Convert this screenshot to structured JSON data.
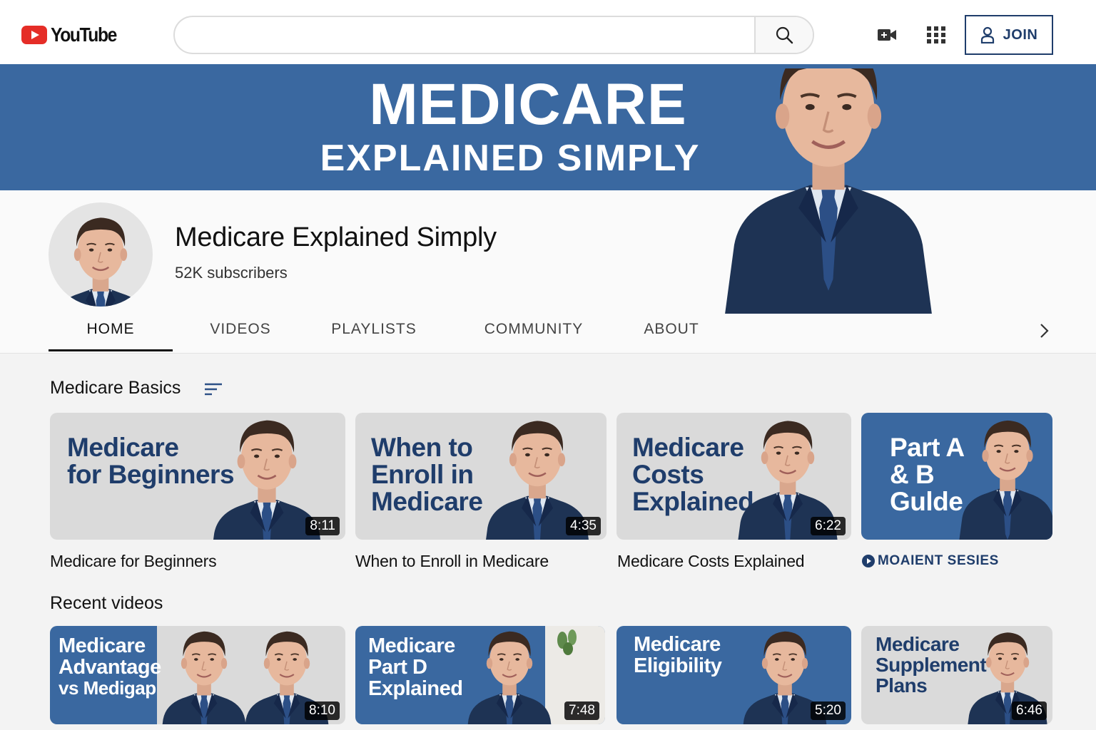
{
  "topbar": {
    "logo_text": "YouTube",
    "search_placeholder": "",
    "join_label": "JOIN"
  },
  "banner": {
    "title": "MEDICARE",
    "subtitle": "EXPLAINED SIMPLY"
  },
  "channel": {
    "name": "Medicare Explained Simply",
    "subscribers": "52K subscribers"
  },
  "tabs": [
    {
      "label": "HOME",
      "active": true
    },
    {
      "label": "VIDEOS",
      "active": false
    },
    {
      "label": "PLAYLISTS",
      "active": false
    },
    {
      "label": "COMMUNITY",
      "active": false
    },
    {
      "label": "ABOUT",
      "active": false
    }
  ],
  "sections": {
    "basics": {
      "title": "Medicare Basics",
      "videos": [
        {
          "thumb_lines": [
            "Medicare",
            "for Beginners"
          ],
          "duration": "8:11",
          "title": "Medicare for Beginners",
          "style": "grey"
        },
        {
          "thumb_lines": [
            "When to",
            "Enroll in",
            "Medicare"
          ],
          "duration": "4:35",
          "title": "When to Enroll in Medicare",
          "style": "grey"
        },
        {
          "thumb_lines": [
            "Medicare",
            "Costs",
            "Explained"
          ],
          "duration": "6:22",
          "title": "Medicare Costs Explained",
          "style": "grey"
        },
        {
          "thumb_lines": [
            "Part A",
            "& B",
            "Gulde"
          ],
          "duration": "",
          "title": "MOAIENT SESIES",
          "style": "blue",
          "is_playlist": true
        }
      ]
    },
    "recent": {
      "title": "Recent videos",
      "videos": [
        {
          "thumb_lines": [
            "Medicare",
            "Advantage",
            "vs Medigap"
          ],
          "duration": "8:10",
          "style": "split"
        },
        {
          "thumb_lines": [
            "Medicare",
            "Part D",
            "Explained"
          ],
          "duration": "7:48",
          "style": "blue"
        },
        {
          "thumb_lines": [
            "Medicare",
            "Eligibility"
          ],
          "duration": "5:20",
          "style": "blue"
        },
        {
          "thumb_lines": [
            "Medicare",
            "Supplement",
            "Plans"
          ],
          "duration": "6:46",
          "style": "grey"
        }
      ]
    }
  },
  "colors": {
    "brand_red": "#e52d27",
    "banner_blue": "#3a68a0",
    "navy": "#1f3d6b",
    "suit": "#1e3354"
  },
  "icons": [
    "search-icon",
    "video-camera-icon",
    "apps-grid-icon",
    "user-icon",
    "sort-icon",
    "chevron-right-icon",
    "play-icon"
  ]
}
